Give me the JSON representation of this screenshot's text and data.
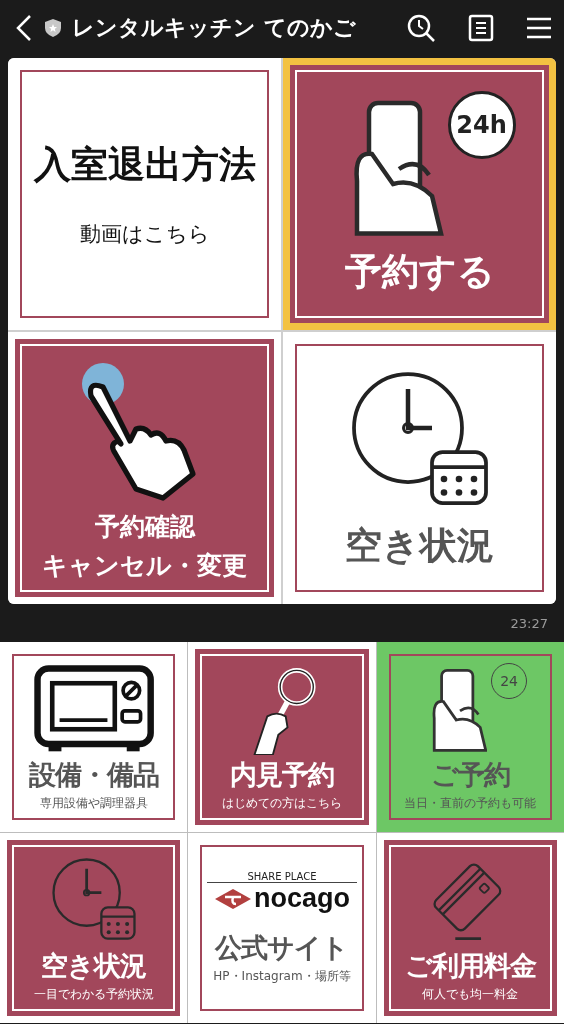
{
  "header": {
    "title": "レンタルキッチン てのかご"
  },
  "message_menu": {
    "tiles": [
      {
        "kind": "text",
        "filled": false,
        "selected": false,
        "title": "入室退出方法",
        "subtitle": "動画はこちら"
      },
      {
        "kind": "phone",
        "filled": true,
        "selected": true,
        "color": "#f3c242",
        "badge": "24h",
        "title": "予約する"
      },
      {
        "kind": "pointer",
        "filled": true,
        "selected": false,
        "title": "予約確認",
        "subtitle": "キャンセル・変更"
      },
      {
        "kind": "clock",
        "filled": false,
        "selected": false,
        "title": "空き状況"
      }
    ]
  },
  "message_time": "23:27",
  "rich_menu": {
    "tiles": [
      {
        "kind": "microwave",
        "filled": false,
        "selected": false,
        "title": "設備・備品",
        "subtitle": "専用設備や調理器具"
      },
      {
        "kind": "magnifier",
        "filled": true,
        "selected": false,
        "title": "内見予約",
        "subtitle": "はじめての方はこちら"
      },
      {
        "kind": "phone",
        "filled": false,
        "selected": true,
        "color": "#6dc765",
        "badge": "24",
        "title": "ご予約",
        "subtitle": "当日・直前の予約も可能"
      },
      {
        "kind": "clock",
        "filled": true,
        "selected": false,
        "title": "空き状況",
        "subtitle": "一目でわかる予約状況"
      },
      {
        "kind": "logo",
        "filled": false,
        "selected": false,
        "logo": {
          "tagline": "SHARE PLACE",
          "name": "nocago"
        },
        "title": "公式サイト",
        "subtitle": "HP・Instagram・場所等"
      },
      {
        "kind": "card",
        "filled": true,
        "selected": false,
        "title": "ご利用料金",
        "subtitle": "何人でも均一料金"
      }
    ]
  }
}
